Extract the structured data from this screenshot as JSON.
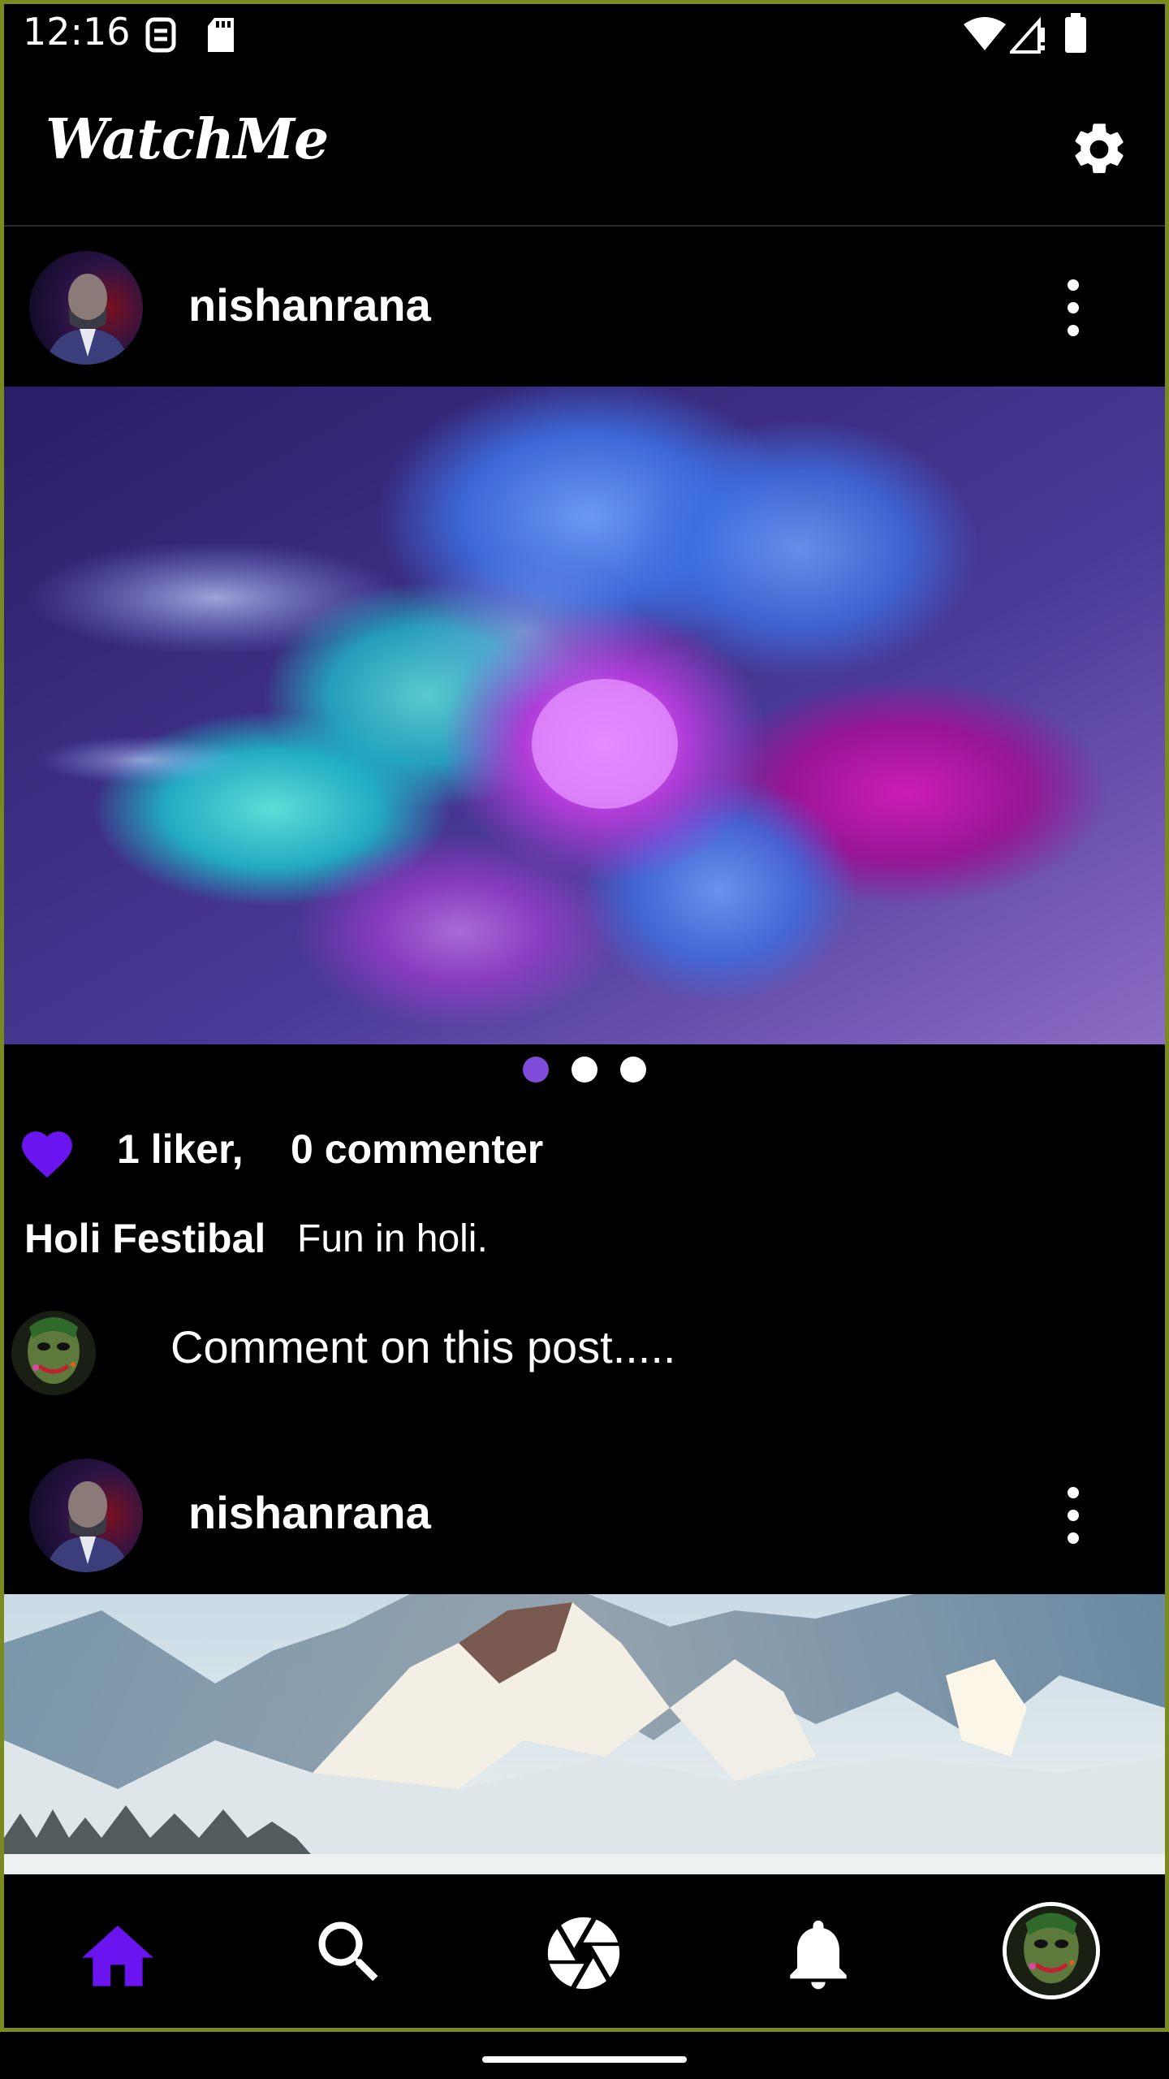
{
  "status_bar": {
    "time": "12:16",
    "icons": [
      "sim-icon",
      "sd-card-icon",
      "wifi-icon",
      "signal-icon",
      "battery-icon"
    ]
  },
  "app_bar": {
    "title": "WatchMe",
    "settings_icon": "gear-icon"
  },
  "posts": [
    {
      "username": "nishanrana",
      "avatar": "user-avatar",
      "menu_icon": "more-vert-icon",
      "image": "holi-color-powder-explosion",
      "carousel_count": 3,
      "carousel_active": 0,
      "likes": "1 liker,",
      "comments": "0 commenter",
      "caption_title": "Holi Festibal",
      "caption_text": "Fun in holi.",
      "comment_placeholder": "Comment on this post....."
    },
    {
      "username": "nishanrana",
      "avatar": "user-avatar",
      "menu_icon": "more-vert-icon",
      "image": "snowy-mountains"
    }
  ],
  "bottom_nav": {
    "items": [
      "home-icon",
      "search-icon",
      "camera-shutter-icon",
      "bell-icon",
      "profile-avatar"
    ],
    "active": "home-icon"
  },
  "colors": {
    "accent": "#6a14f0",
    "dot_active": "#7f4bd9",
    "background": "#000000"
  }
}
